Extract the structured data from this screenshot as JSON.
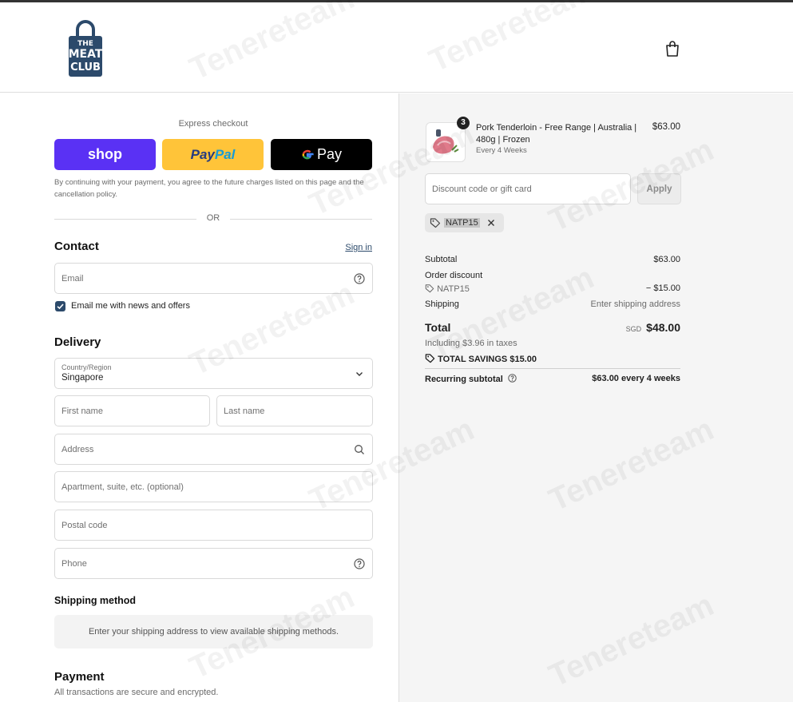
{
  "brand": {
    "logo_top": "THE",
    "logo_mid": "MEAT",
    "logo_bottom": "CLUB"
  },
  "express": {
    "title": "Express checkout",
    "shop_label": "shop",
    "paypal_a": "Pay",
    "paypal_b": "Pal",
    "gpay_label": "Pay",
    "terms": "By continuing with your payment, you agree to the future charges listed on this page and the cancellation policy.",
    "or": "OR"
  },
  "contact": {
    "heading": "Contact",
    "signin": "Sign in",
    "email_placeholder": "Email",
    "newsletter_label": "Email me with news and offers",
    "newsletter_checked": true
  },
  "delivery": {
    "heading": "Delivery",
    "country_label": "Country/Region",
    "country_value": "Singapore",
    "first_name": "First name",
    "last_name": "Last name",
    "address": "Address",
    "apartment": "Apartment, suite, etc. (optional)",
    "postal": "Postal code",
    "phone": "Phone"
  },
  "shipping_method": {
    "heading": "Shipping method",
    "message": "Enter your shipping address to view available shipping methods."
  },
  "payment": {
    "heading": "Payment",
    "note": "All transactions are secure and encrypted."
  },
  "summary": {
    "product": {
      "name": "Pork Tenderloin - Free Range | Australia | 480g | Frozen",
      "subscription": "Every 4 Weeks",
      "price": "$63.00",
      "quantity": "3"
    },
    "discount_placeholder": "Discount code or gift card",
    "apply": "Apply",
    "code": "NATP15",
    "subtotal_label": "Subtotal",
    "subtotal_value": "$63.00",
    "order_discount_label": "Order discount",
    "order_discount_code": "NATP15",
    "order_discount_value": "− $15.00",
    "shipping_label": "Shipping",
    "shipping_value": "Enter shipping address",
    "total_label": "Total",
    "currency": "SGD",
    "total_value": "$48.00",
    "taxes": "Including $3.96 in taxes",
    "savings_label": "TOTAL SAVINGS",
    "savings_value": "$15.00",
    "recurring_label": "Recurring subtotal",
    "recurring_value": "$63.00 every 4 weeks"
  },
  "watermark": "Tenereteam",
  "colors": {
    "accent": "#2c4a6b",
    "shop": "#5a31f4",
    "paypal": "#ffc439",
    "gpay": "#000000"
  }
}
